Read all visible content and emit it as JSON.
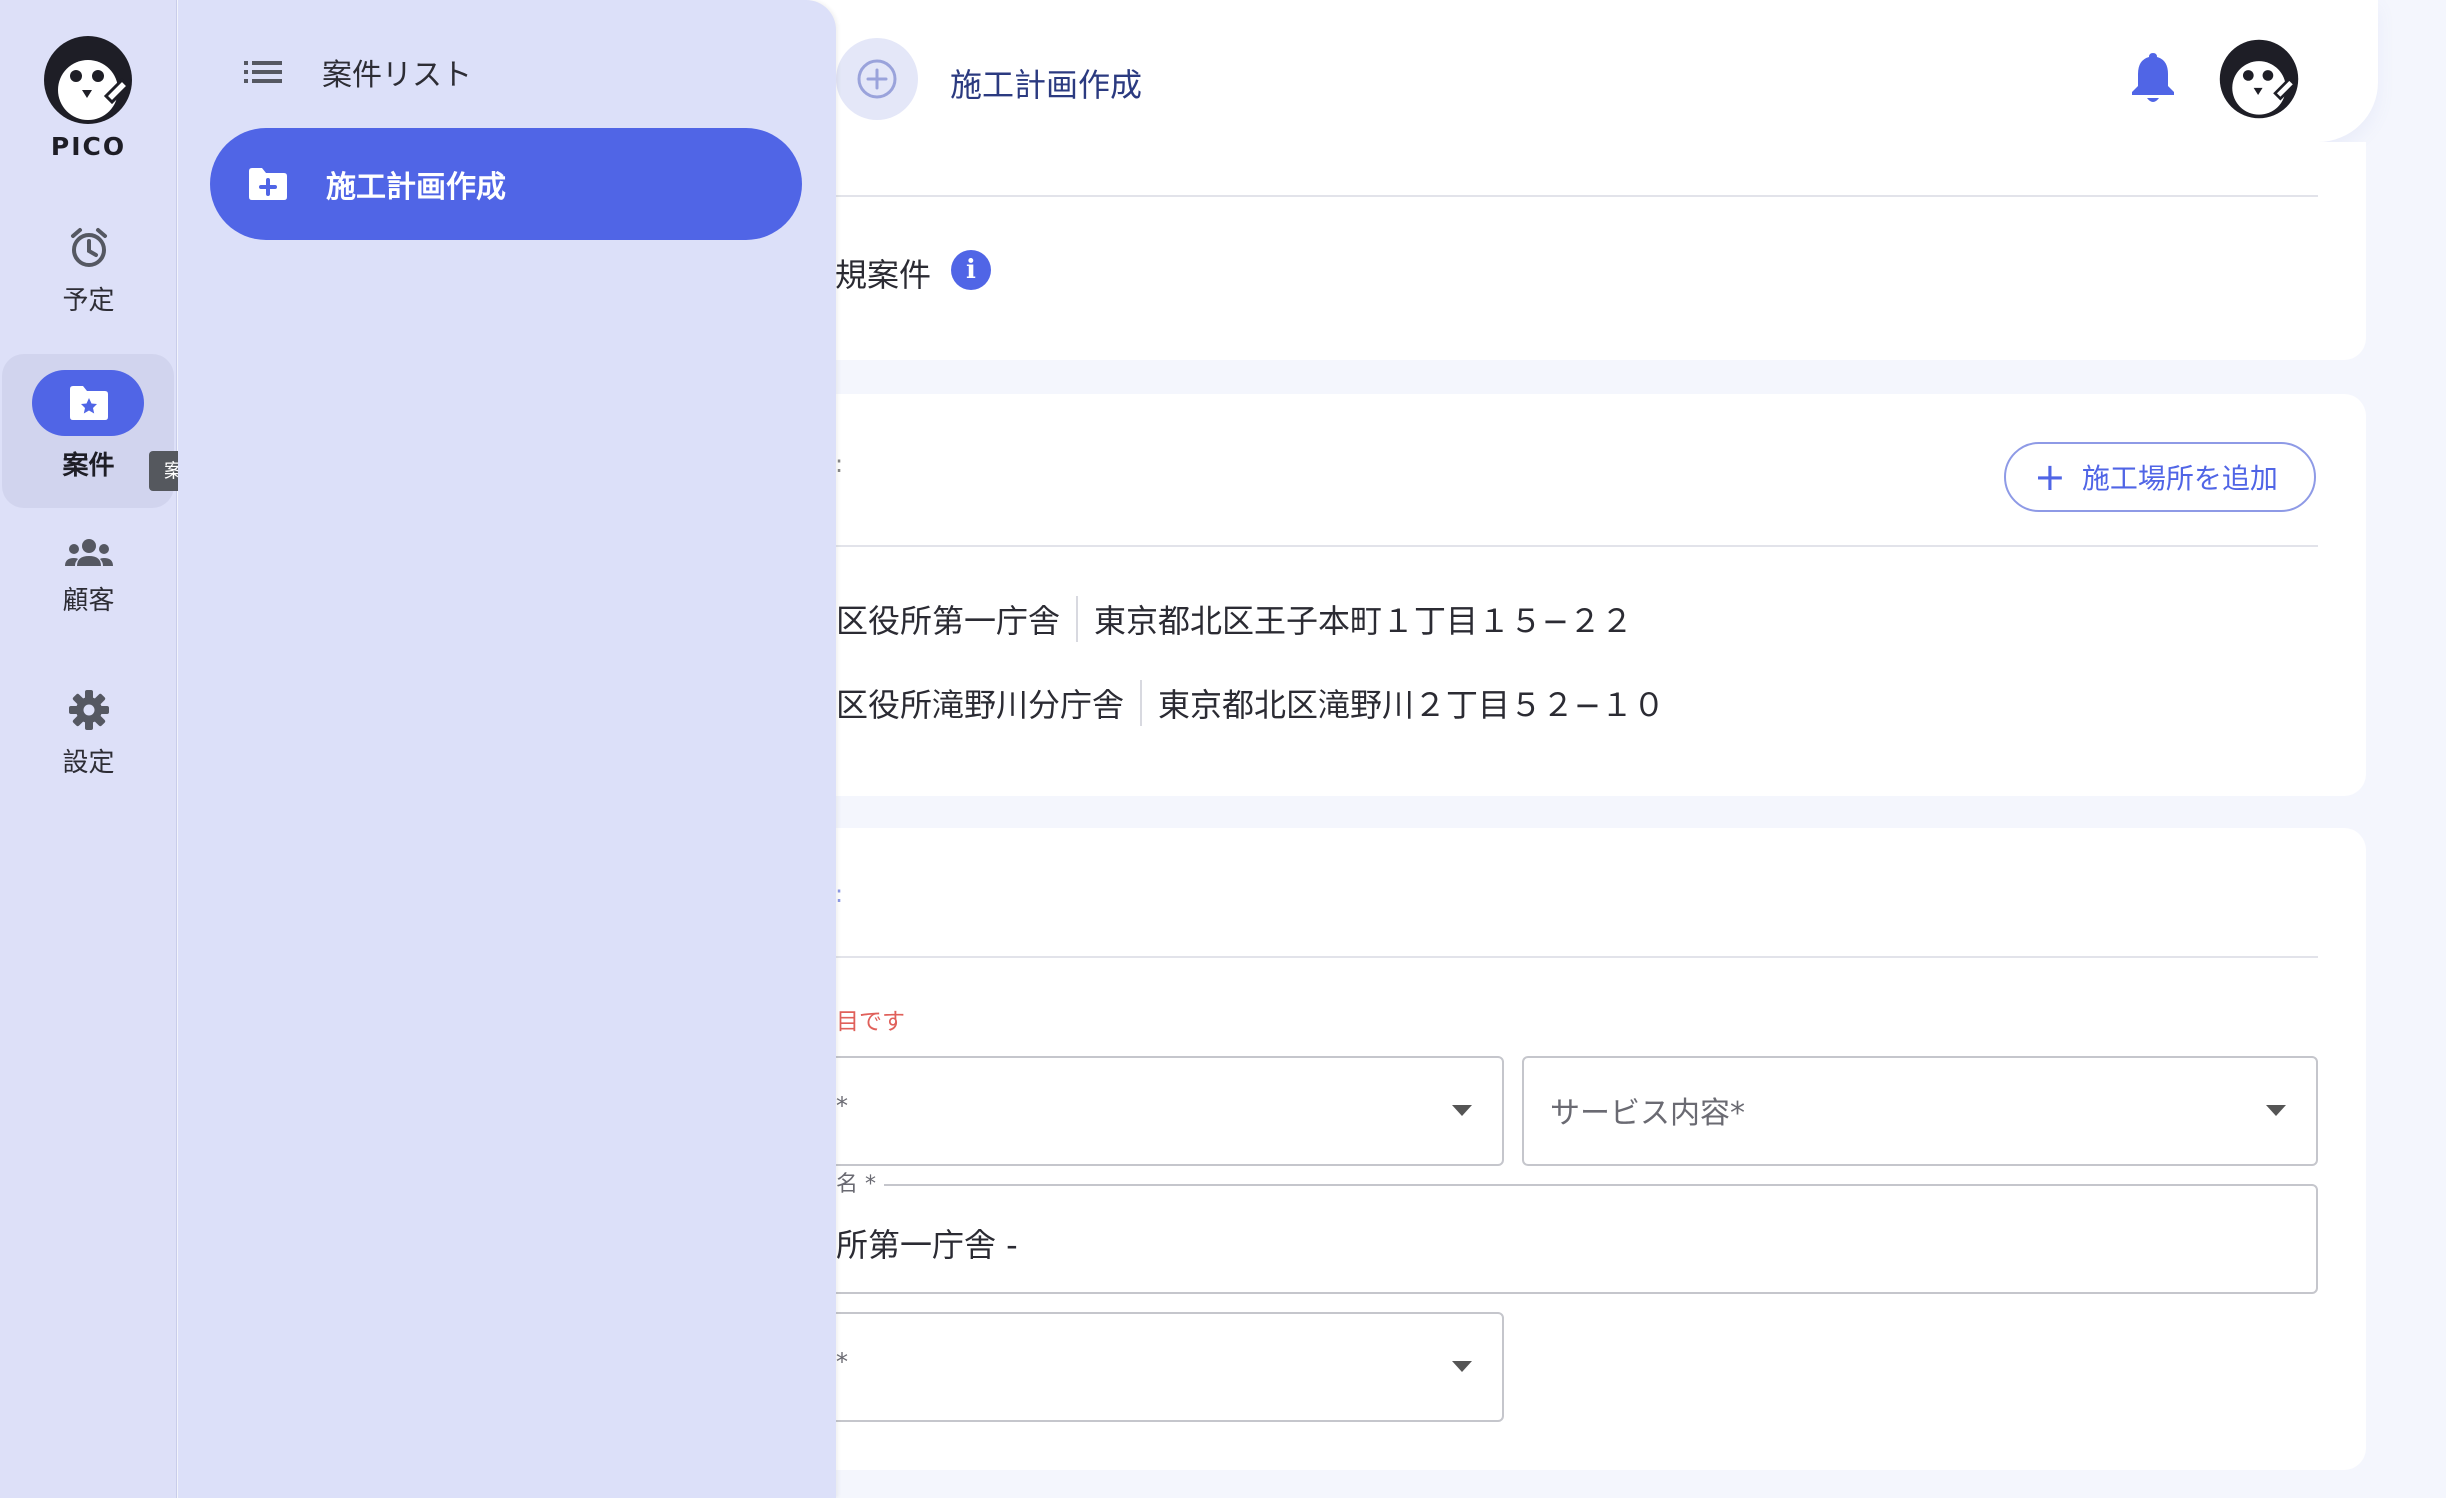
{
  "app": {
    "name": "PICO"
  },
  "rail": {
    "items": [
      {
        "label": "予定",
        "icon": "alarm-clock-icon"
      },
      {
        "label": "案件",
        "icon": "folder-star-icon",
        "active": true
      },
      {
        "label": "顧客",
        "icon": "group-icon"
      },
      {
        "label": "設定",
        "icon": "gear-icon"
      }
    ],
    "tooltip": "案件"
  },
  "drawer": {
    "list_label": "案件リスト",
    "create_label": "施工計画作成"
  },
  "topbar": {
    "title": "施工計画作成"
  },
  "project_card": {
    "title": "規案件",
    "info_glyph": "i"
  },
  "sites_card": {
    "mark": ":",
    "add_button": "施工場所を追加",
    "sites": [
      {
        "name": "区役所第一庁舎",
        "address": "東京都北区王子本町１丁目１５−２２"
      },
      {
        "name": "区役所滝野川分庁舎",
        "address": "東京都北区滝野川２丁目５２−１０"
      }
    ]
  },
  "form_card": {
    "mark": ":",
    "required_note": "目です",
    "select1_star": "*",
    "service_placeholder": "サービス内容*",
    "name_label": "名 *",
    "name_value": "所第一庁舎 -",
    "select3_star": "*"
  },
  "colors": {
    "accent": "#5065e6",
    "rail_bg": "#dde0f8",
    "page_bg": "#f4f6fd",
    "error": "#e0605a"
  }
}
